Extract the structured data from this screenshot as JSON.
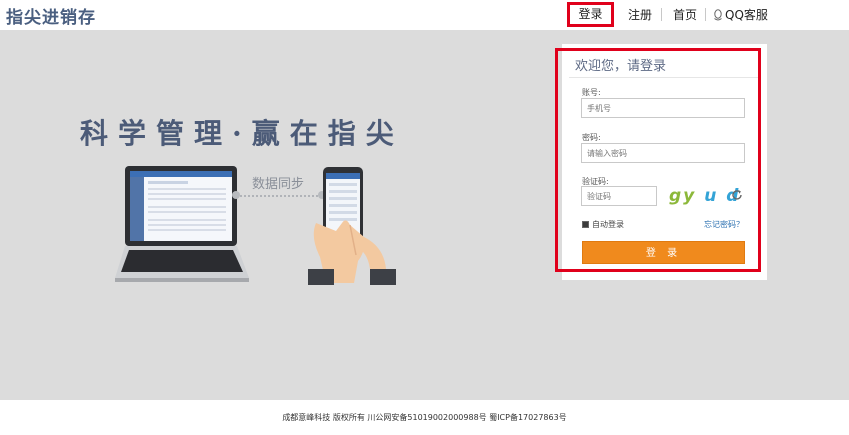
{
  "header": {
    "logo": "指尖进销存",
    "nav": {
      "login": "登录",
      "register": "注册",
      "home": "首页",
      "qq_service": "QQ客服"
    }
  },
  "hero": {
    "slogan": "科学管理·赢在指尖",
    "sync_label": "数据同步"
  },
  "login": {
    "title": "欢迎您，请登录",
    "account_label": "账号:",
    "account_placeholder": "手机号",
    "password_label": "密码:",
    "password_placeholder": "请输入密码",
    "captcha_label": "验证码:",
    "captcha_placeholder": "验证码",
    "captcha_chars": [
      "g",
      "y",
      "u",
      "d"
    ],
    "remember_label": "自动登录",
    "remember_checked": true,
    "forgot_label": "忘记密码？",
    "submit_label": "登 录"
  },
  "footer": {
    "text": "成都意峰科技 版权所有  川公网安备51019002000988号 蜀ICP备17027863号"
  },
  "colors": {
    "accent": "#f08a1d",
    "highlight_border": "#e0001b",
    "logo": "#4a5f80",
    "background": "#dcdcdc"
  }
}
